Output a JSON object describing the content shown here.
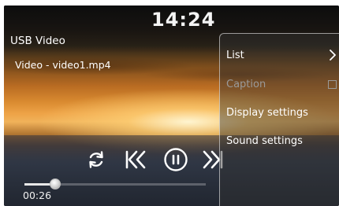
{
  "status_bar": {
    "time": "14:24"
  },
  "player": {
    "source_title": "USB Video",
    "file_name": "Video - video1.mp4",
    "elapsed": "00:26",
    "progress": 0.17
  },
  "menu": {
    "items": [
      {
        "label": "List",
        "enabled": true
      },
      {
        "label": "Caption",
        "enabled": false,
        "checked": false
      },
      {
        "label": "Display settings",
        "enabled": true
      },
      {
        "label": "Sound settings",
        "enabled": true
      }
    ]
  },
  "icons": [
    "repeat-icon",
    "previous-icon",
    "pause-icon",
    "next-icon",
    "chevron-right-icon",
    "checkbox-icon"
  ]
}
